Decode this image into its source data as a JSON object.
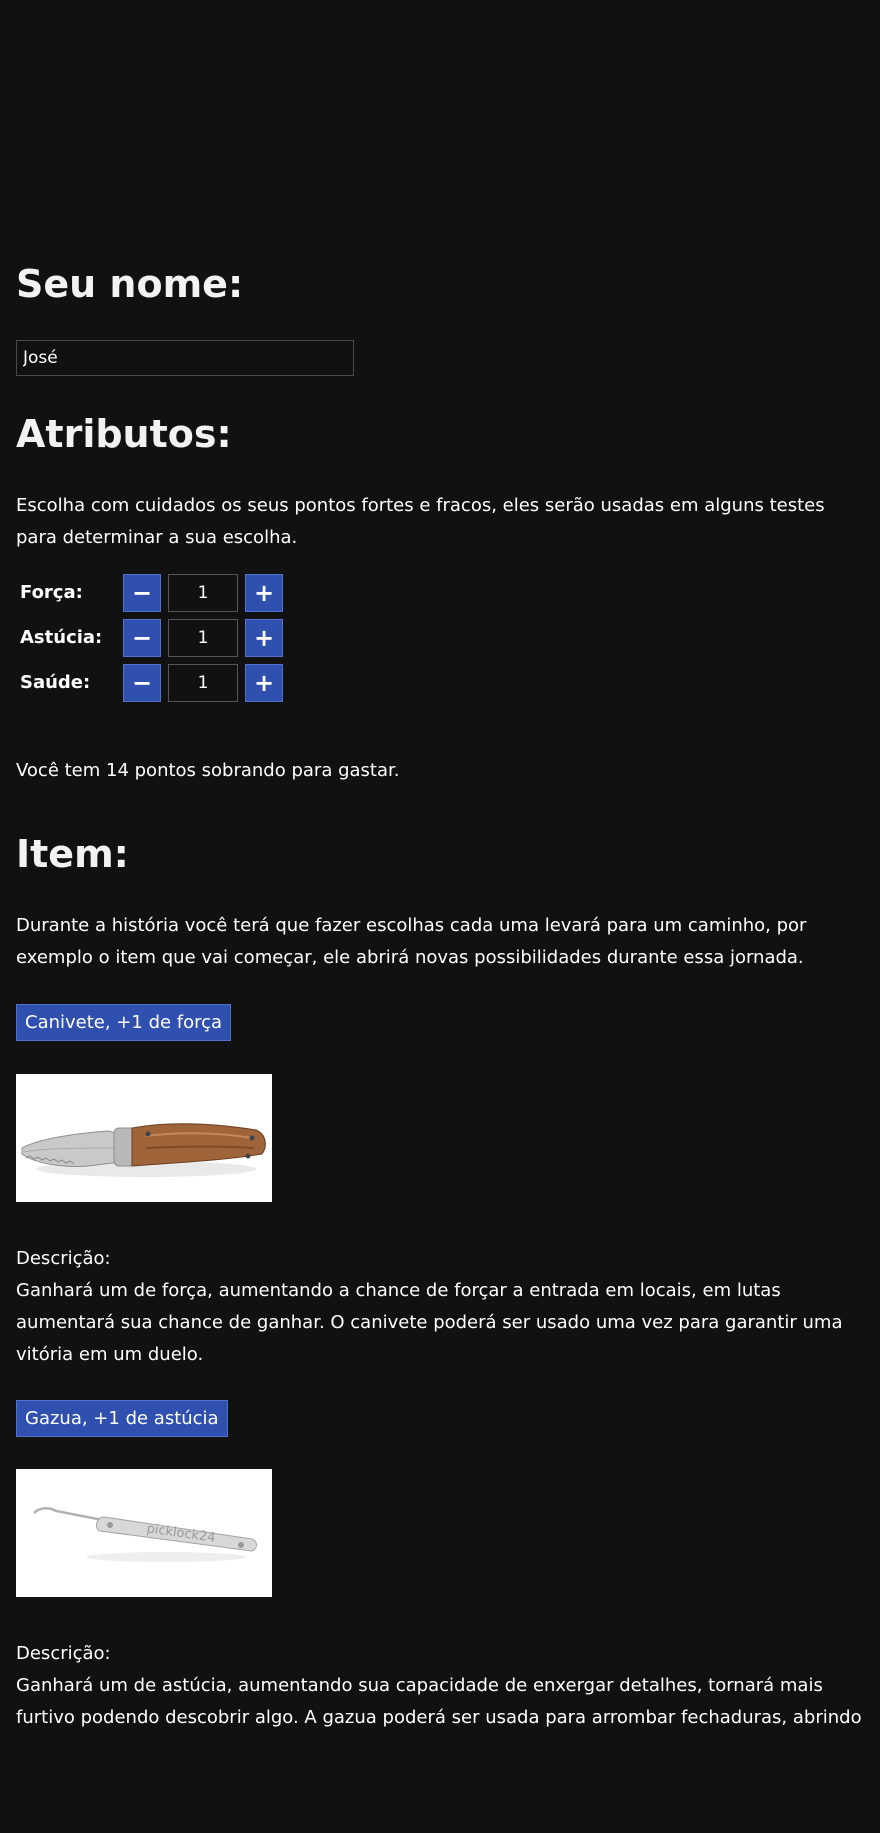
{
  "name_section": {
    "title": "Seu nome:",
    "input_value": "José"
  },
  "attributes_section": {
    "title": "Atributos:",
    "description": "Escolha com cuidados os seus pontos fortes e fracos, eles serão usadas em alguns testes para determinar a sua escolha.",
    "minus_symbol": "−",
    "plus_symbol": "+",
    "items": [
      {
        "label": "Força:",
        "value": "1"
      },
      {
        "label": "Astúcia:",
        "value": "1"
      },
      {
        "label": "Saúde:",
        "value": "1"
      }
    ],
    "points_remaining_text": "Você tem 14 pontos sobrando para gastar."
  },
  "item_section": {
    "title": "Item:",
    "description": "Durante a história você terá que fazer escolhas cada uma levará para um caminho, por exemplo o item que vai começar, ele abrirá novas possibilidades durante essa jornada.",
    "items": [
      {
        "button_label": "Canivete, +1 de força",
        "image_icon": "pocket-knife-image",
        "description_label": "Descrição:",
        "description": "Ganhará um de força, aumentando a chance de forçar a entrada em locais, em lutas aumentará sua chance de ganhar. O canivete poderá ser usado uma vez para garantir uma vitória em um duelo."
      },
      {
        "button_label": "Gazua, +1 de astúcia",
        "image_icon": "lock-pick-image",
        "image_text": "picklock24",
        "description_label": "Descrição:",
        "description": "Ganhará um de astúcia, aumentando sua capacidade de enxergar detalhes, tornará mais furtivo podendo descobrir algo. A gazua poderá ser usada para arrombar fechaduras, abrindo"
      }
    ]
  },
  "colors": {
    "background": "#111111",
    "button": "#3050b0",
    "text": "#ffffff"
  }
}
